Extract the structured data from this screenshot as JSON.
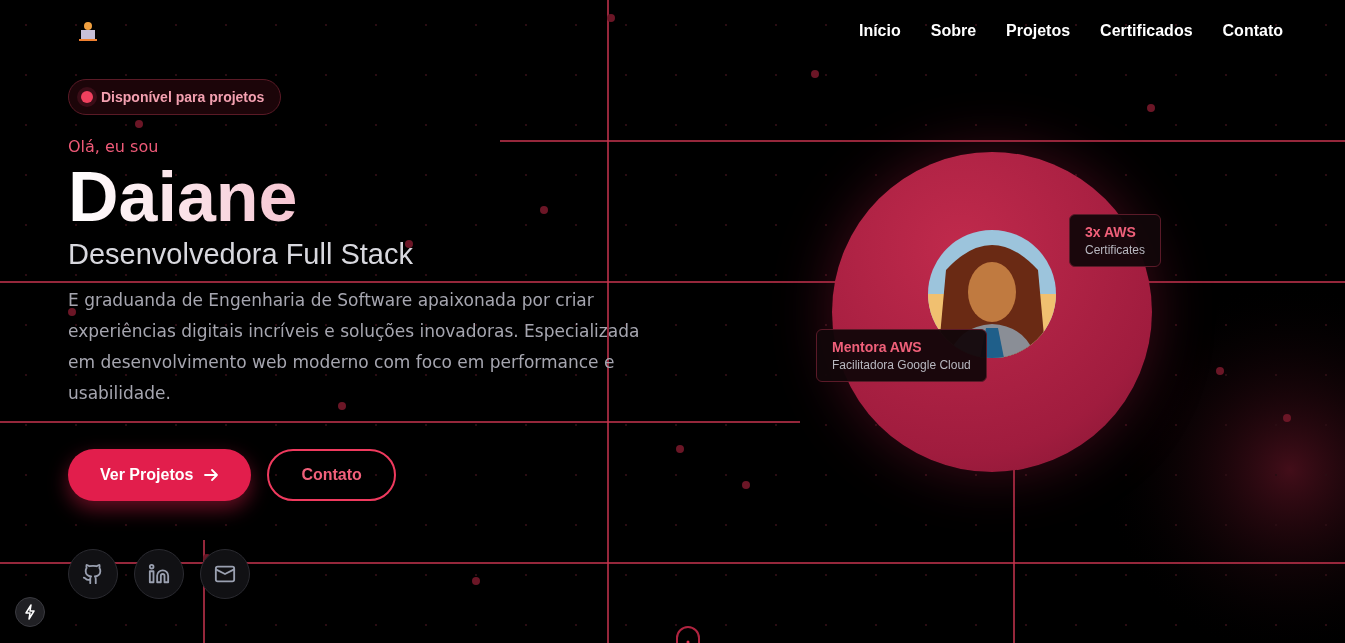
{
  "nav": {
    "items": [
      {
        "label": "Início"
      },
      {
        "label": "Sobre"
      },
      {
        "label": "Projetos"
      },
      {
        "label": "Certificados"
      },
      {
        "label": "Contato"
      }
    ]
  },
  "hero": {
    "status": "Disponível para projetos",
    "greeting": "Olá, eu sou",
    "name": "Daiane",
    "role": "Desenvolvedora Full Stack",
    "description": "E graduanda de Engenharia de Software apaixonada por criar experiências digitais incríveis e soluções inovadoras. Especializada em desenvolvimento web moderno com foco em performance e usabilidade.",
    "buttons": [
      {
        "label": "Ver Projetos",
        "kind": "primary"
      },
      {
        "label": "Contato",
        "kind": "outline"
      }
    ],
    "socials": [
      {
        "kind": "github"
      },
      {
        "kind": "linkedin"
      },
      {
        "kind": "mail"
      }
    ]
  },
  "cards": [
    {
      "title": "3x AWS",
      "subtitle": "Certificates",
      "kind": "top"
    },
    {
      "title": "Mentora AWS",
      "subtitle": "Facilitadora Google Cloud",
      "kind": "bottom"
    }
  ]
}
